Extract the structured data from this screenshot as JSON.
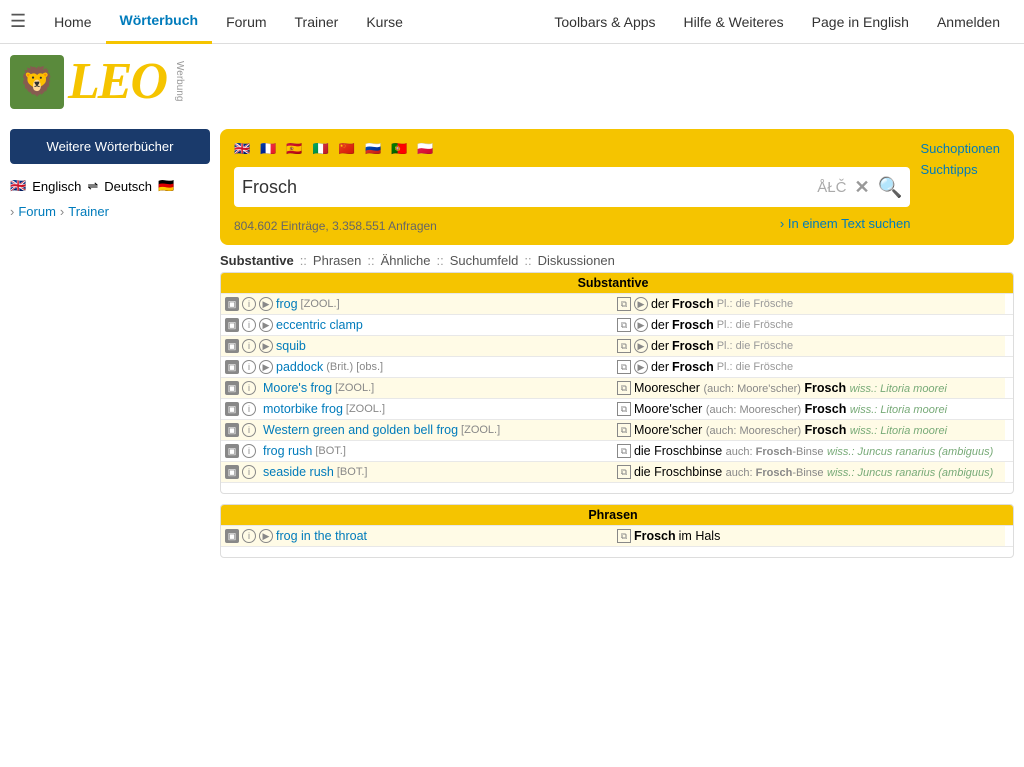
{
  "nav": {
    "hamburger": "☰",
    "items": [
      {
        "label": "Home",
        "active": false
      },
      {
        "label": "Wörterbuch",
        "active": true
      },
      {
        "label": "Forum",
        "active": false
      },
      {
        "label": "Trainer",
        "active": false
      },
      {
        "label": "Kurse",
        "active": false
      }
    ],
    "right_items": [
      {
        "label": "Toolbars & Apps"
      },
      {
        "label": "Hilfe & Weiteres"
      },
      {
        "label": "Page in English"
      },
      {
        "label": "Anmelden"
      }
    ]
  },
  "logo": {
    "text": "LEO",
    "werbung": "Werbung"
  },
  "sidebar": {
    "btn_label": "Weitere Wörterbücher",
    "lang_label": "Englisch",
    "arrow": "⇌",
    "lang2": "Deutsch",
    "forum_label": "Forum",
    "trainer_label": "Trainer"
  },
  "flags": [
    "🇬🇧",
    "🇫🇷",
    "🇪🇸",
    "🇮🇹",
    "🇨🇳",
    "🇷🇺",
    "🇵🇹",
    "🇵🇱"
  ],
  "search": {
    "value": "Frosch",
    "atc_label": "ÅŁČ",
    "clear_label": "✕",
    "go_label": "🔍",
    "stats": "804.602 Einträge, 3.358.551 Anfragen",
    "in_text_label": "› In einem Text suchen",
    "options": [
      "Suchoptionen",
      "Suchtipps"
    ]
  },
  "results_tabs": [
    "Substantive",
    "Phrasen",
    "Ähnliche",
    "Suchumfeld",
    "Diskussionen"
  ],
  "sections": [
    {
      "header": "Substantive",
      "rows": [
        {
          "en_play": true,
          "en": "frog",
          "en_tag": "[ZOOL.]",
          "de_copy": true,
          "de_play": true,
          "de_article": "der",
          "de_word": "Frosch",
          "de_pl": "Pl.: die Frösche"
        },
        {
          "en_play": true,
          "en": "eccentric clamp",
          "en_tag": "",
          "de_copy": true,
          "de_play": true,
          "de_article": "der",
          "de_word": "Frosch",
          "de_pl": "Pl.: die Frösche"
        },
        {
          "en_play": true,
          "en": "squib",
          "en_tag": "",
          "de_copy": true,
          "de_play": true,
          "de_article": "der",
          "de_word": "Frosch",
          "de_pl": "Pl.: die Frösche"
        },
        {
          "en_play": true,
          "en": "paddock",
          "en_tag": "(Brit.) [obs.]",
          "de_copy": true,
          "de_play": true,
          "de_article": "der",
          "de_word": "Frosch",
          "de_pl": "Pl.: die Frösche"
        },
        {
          "en_play": false,
          "en": "Moore's frog",
          "en_tag": "[ZOOL.]",
          "de_copy": true,
          "de_play": false,
          "de_article": "Moorescher",
          "de_also": "(auch: Moore'scher)",
          "de_word": "Frosch",
          "de_wiss": "wiss.: Litoria moorei"
        },
        {
          "en_play": false,
          "en": "motorbike frog",
          "en_tag": "[ZOOL.]",
          "de_copy": true,
          "de_play": false,
          "de_article": "Moore'scher",
          "de_also": "(auch: Moorescher)",
          "de_word": "Frosch",
          "de_wiss": "wiss.: Litoria moorei"
        },
        {
          "en_play": false,
          "en": "Western green and golden bell frog",
          "en_tag": "[ZOOL.]",
          "de_copy": true,
          "de_play": false,
          "de_article": "Moore'scher",
          "de_also": "(auch: Moorescher)",
          "de_word": "Frosch",
          "de_wiss": "wiss.: Litoria moorei"
        },
        {
          "en_play": false,
          "en": "frog rush",
          "en_tag": "[BOT.]",
          "de_copy": true,
          "de_play": false,
          "de_article": "die",
          "de_word": "Froschbinse",
          "de_also": "auch:",
          "de_also2": "Frosch-Binse",
          "de_wiss": "wiss.: Juncus ranarius (ambiguus)"
        },
        {
          "en_play": false,
          "en": "seaside rush",
          "en_tag": "[BOT.]",
          "de_copy": true,
          "de_play": false,
          "de_article": "die",
          "de_word": "Froschbinse",
          "de_also": "auch:",
          "de_also2": "Frosch-Binse",
          "de_wiss": "wiss.: Juncus ranarius (ambiguus)"
        }
      ]
    },
    {
      "header": "Phrasen",
      "rows": [
        {
          "en_play": true,
          "en": "frog in the throat",
          "en_tag": "",
          "de_copy": true,
          "de_play": false,
          "de_article": "Frosch",
          "de_word": "im Hals",
          "de_pl": ""
        }
      ]
    }
  ]
}
